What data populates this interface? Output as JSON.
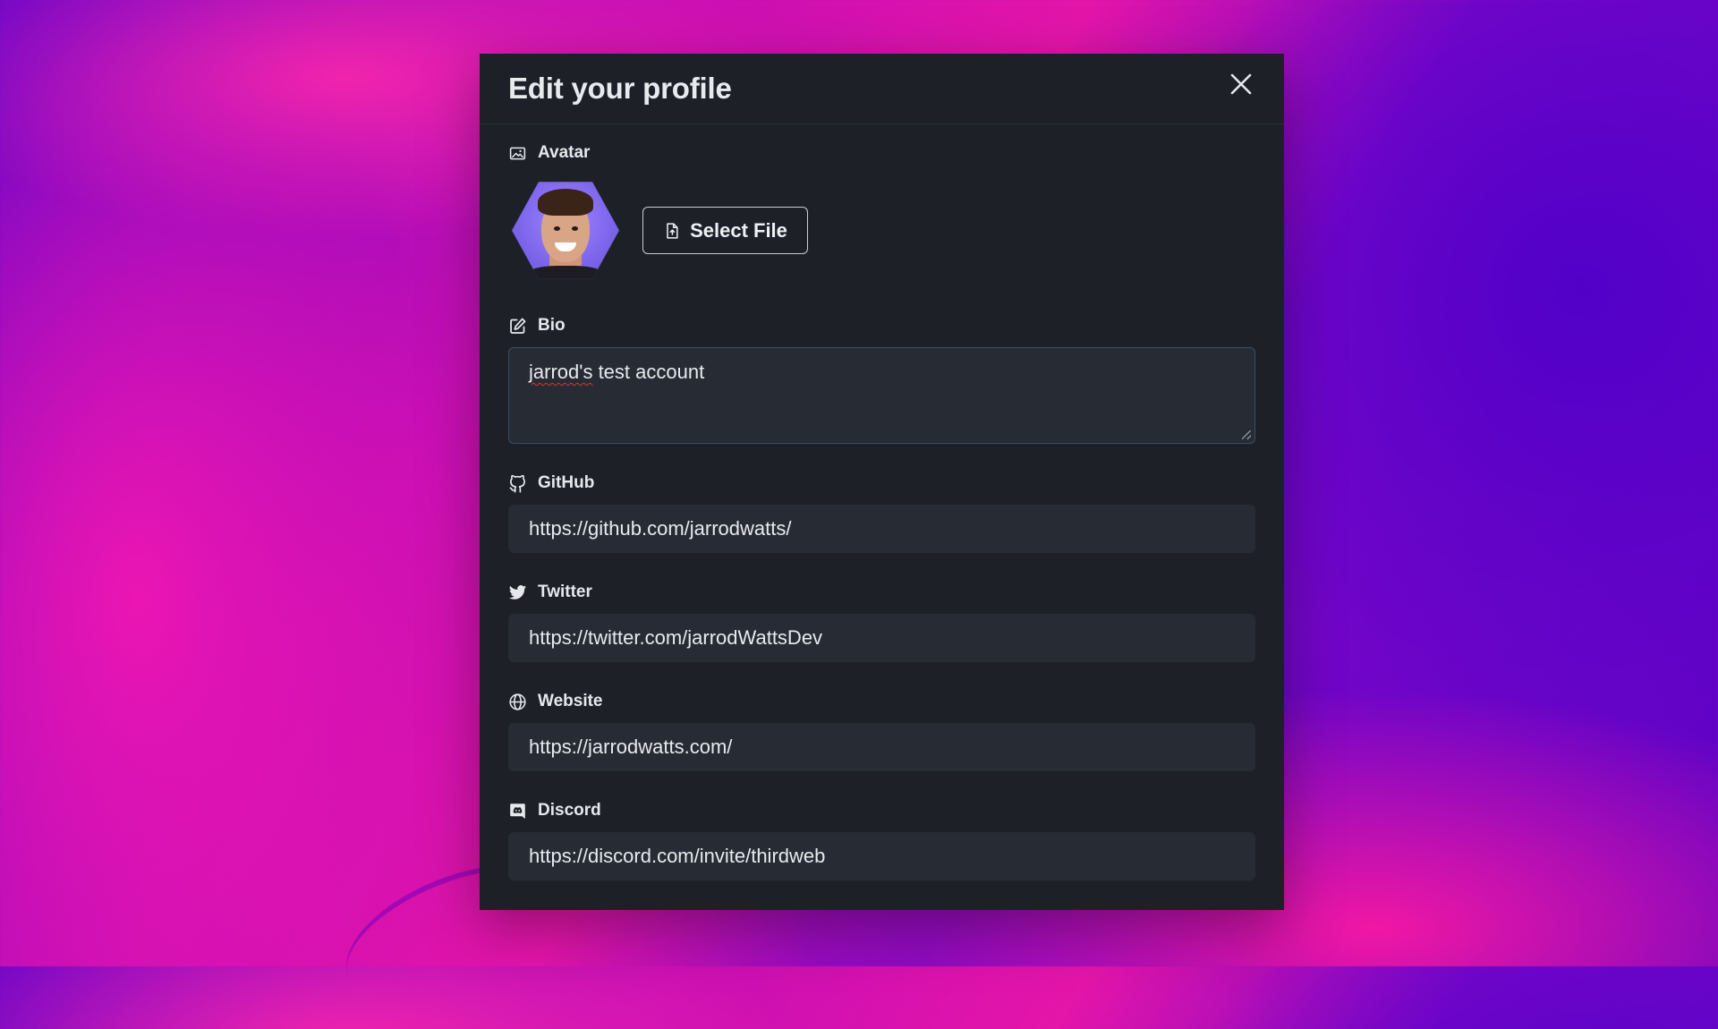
{
  "modal": {
    "title": "Edit your profile"
  },
  "avatar": {
    "label": "Avatar",
    "select_file_label": "Select File"
  },
  "bio": {
    "label": "Bio",
    "misspelled_word": "jarrod's",
    "rest": " test account"
  },
  "github": {
    "label": "GitHub",
    "value": "https://github.com/jarrodwatts/"
  },
  "twitter": {
    "label": "Twitter",
    "value": "https://twitter.com/jarrodWattsDev"
  },
  "website": {
    "label": "Website",
    "value": "https://jarrodwatts.com/"
  },
  "discord": {
    "label": "Discord",
    "value": "https://discord.com/invite/thirdweb"
  },
  "icons": {
    "close": "close-icon",
    "avatar": "image-icon",
    "select_file": "file-upload-icon",
    "bio": "edit-icon",
    "github": "github-icon",
    "twitter": "twitter-icon",
    "website": "globe-icon",
    "discord": "discord-icon"
  },
  "colors": {
    "modal_bg": "#1d2127",
    "input_bg": "#272b33",
    "text": "#e8eaee",
    "avatar_bg": "#7b64ea"
  }
}
